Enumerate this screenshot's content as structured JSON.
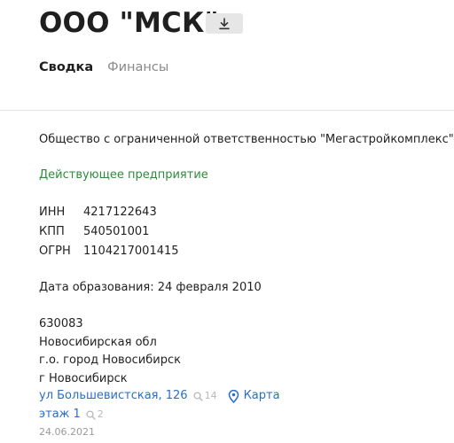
{
  "header": {
    "title": "ООО \"МСК\"",
    "download_icon": "download-icon"
  },
  "tabs": [
    {
      "label": "Сводка",
      "active": true
    },
    {
      "label": "Финансы",
      "active": false
    }
  ],
  "summary": {
    "full_name": "Общество с ограниченной ответственностью \"Мегастройкомплекс\"",
    "status": "Действующее предприятие",
    "status_color": "#2e8b3a",
    "registration": [
      {
        "label": "ИНН",
        "value": "4217122643"
      },
      {
        "label": "КПП",
        "value": "540501001"
      },
      {
        "label": "ОГРН",
        "value": "1104217001415"
      }
    ],
    "founded": "Дата образования: 24 февраля 2010",
    "address": {
      "postal_code": "630083",
      "region": "Новосибирская обл",
      "district": "г.о. город Новосибирск",
      "city": "г Новосибирск",
      "street": "ул Большевистская, 126",
      "street_count": "14",
      "map_label": "Карта",
      "floor": "этаж 1",
      "floor_count": "2"
    },
    "updated_date": "24.06.2021"
  },
  "colors": {
    "link": "#2a6fc6",
    "muted": "#8a8a8a",
    "count": "#b8b8b8"
  }
}
